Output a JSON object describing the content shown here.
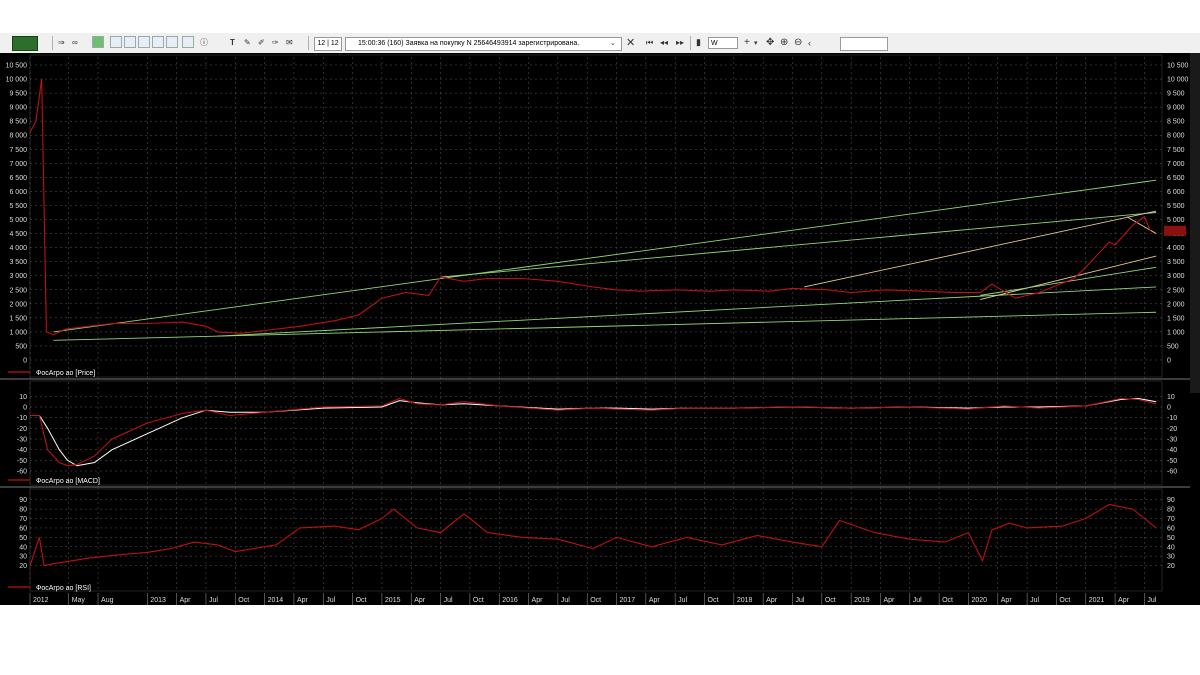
{
  "toolbar": {
    "page_counter": "12 | 12",
    "message": "15:00:36  (160) Заявка на покупку N 25646493914 зарегистрирована.",
    "timeframe": "W",
    "icons": [
      "terminal-logo-icon",
      "arrow-icon",
      "link-icon",
      "refresh-icon",
      "window-icon",
      "table-icon",
      "list-icon",
      "zoom-icon",
      "filter-icon",
      "info-icon",
      "text-tool-icon",
      "pencil-icon",
      "eraser-icon",
      "brush-icon",
      "message-icon",
      "close-icon",
      "first-icon",
      "prev-icon",
      "next-icon",
      "chart-type-icon",
      "crosshair-icon",
      "move-icon",
      "zoom-in-icon",
      "zoom-out-icon"
    ]
  },
  "panes": {
    "price": {
      "legend": "ФосАгро ао [Price]",
      "color": "#c01010"
    },
    "macd": {
      "legend": "ФосАгро ао [MACD]",
      "color": "#c01010",
      "signal_color": "#ffffff"
    },
    "rsi": {
      "legend": "ФосАгро ао [RSI]",
      "color": "#c01010"
    }
  },
  "chart_data": [
    {
      "type": "line",
      "name": "price",
      "ylim": [
        0,
        10500
      ],
      "yticks": [
        0,
        500,
        1000,
        1500,
        2000,
        2500,
        3000,
        3500,
        4000,
        4500,
        5000,
        5500,
        6000,
        6500,
        7000,
        7500,
        8000,
        8500,
        9000,
        9500,
        10000,
        10500
      ],
      "ytick_labels": [
        "0",
        "500",
        "1 000",
        "1 500",
        "2 000",
        "2 500",
        "3 000",
        "3 500",
        "4 000",
        "4 500",
        "5 000",
        "5 500",
        "6 000",
        "6 500",
        "7 000",
        "7 500",
        "8 000",
        "8 500",
        "9 000",
        "9 500",
        "10 000",
        "10 500"
      ],
      "x": [
        2012.0,
        2012.05,
        2012.1,
        2012.14,
        2012.2,
        2012.3,
        2012.5,
        2012.7,
        2013.0,
        2013.3,
        2013.5,
        2013.6,
        2013.8,
        2014.0,
        2014.3,
        2014.6,
        2014.8,
        2015.0,
        2015.2,
        2015.4,
        2015.5,
        2015.7,
        2015.9,
        2016.2,
        2016.5,
        2016.8,
        2017.0,
        2017.2,
        2017.5,
        2017.8,
        2018.0,
        2018.3,
        2018.5,
        2018.8,
        2019.0,
        2019.3,
        2019.6,
        2019.9,
        2020.1,
        2020.2,
        2020.4,
        2020.6,
        2020.9,
        2021.0,
        2021.2,
        2021.25,
        2021.4,
        2021.5,
        2021.55
      ],
      "values": [
        8100,
        8500,
        10000,
        1000,
        900,
        1100,
        1200,
        1300,
        1300,
        1350,
        1200,
        1000,
        950,
        1050,
        1200,
        1400,
        1600,
        2200,
        2400,
        2300,
        2950,
        2800,
        2900,
        2900,
        2800,
        2600,
        2500,
        2450,
        2500,
        2450,
        2500,
        2450,
        2550,
        2500,
        2400,
        2500,
        2450,
        2400,
        2400,
        2700,
        2200,
        2400,
        2900,
        3300,
        4200,
        4100,
        4800,
        5100,
        4600
      ],
      "trend_lines": [
        {
          "from": [
            2012.2,
            1000
          ],
          "to": [
            2021.6,
            6400
          ],
          "color": "#90d878"
        },
        {
          "from": [
            2012.2,
            700
          ],
          "to": [
            2021.6,
            1700
          ],
          "color": "#90d878"
        },
        {
          "from": [
            2013.6,
            850
          ],
          "to": [
            2021.6,
            2600
          ],
          "color": "#90d878"
        },
        {
          "from": [
            2015.5,
            2950
          ],
          "to": [
            2021.6,
            5250
          ],
          "color": "#90d878"
        },
        {
          "from": [
            2018.6,
            2600
          ],
          "to": [
            2021.6,
            5300
          ],
          "color": "#e8c890"
        },
        {
          "from": [
            2020.1,
            2150
          ],
          "to": [
            2021.6,
            3700
          ],
          "color": "#e8c890"
        },
        {
          "from": [
            2020.1,
            2300
          ],
          "to": [
            2021.6,
            3300
          ],
          "color": "#90d878"
        },
        {
          "from": [
            2021.35,
            5100
          ],
          "to": [
            2021.6,
            4500
          ],
          "color": "#e8c890"
        }
      ],
      "last_value_label_color": "#8a1010"
    },
    {
      "type": "line",
      "name": "macd",
      "ylim": [
        -60,
        15
      ],
      "yticks": [
        -60,
        -50,
        -40,
        -30,
        -20,
        -10,
        0,
        10
      ],
      "x": [
        2012.0,
        2012.08,
        2012.15,
        2012.25,
        2012.32,
        2012.4,
        2012.55,
        2012.7,
        2013.0,
        2013.3,
        2013.5,
        2013.7,
        2014.0,
        2014.5,
        2015.0,
        2015.15,
        2015.3,
        2015.5,
        2015.7,
        2016.0,
        2016.5,
        2016.8,
        2017.0,
        2017.3,
        2017.6,
        2018.0,
        2018.5,
        2019.0,
        2019.5,
        2020.0,
        2020.3,
        2020.6,
        2021.0,
        2021.3,
        2021.45,
        2021.6
      ],
      "values": [
        -8,
        -8,
        -40,
        -52,
        -55,
        -54,
        -46,
        -30,
        -15,
        -6,
        -3,
        -8,
        -5,
        0,
        1,
        8,
        3,
        2,
        5,
        1,
        -3,
        -1,
        -2,
        -3,
        -1,
        -1,
        0,
        -1,
        0,
        -2,
        1,
        -1,
        1,
        8,
        7,
        3
      ],
      "signal": [
        -8,
        -8,
        -20,
        -40,
        -50,
        -55,
        -52,
        -40,
        -25,
        -10,
        -3,
        -5,
        -5,
        -1,
        0,
        6,
        4,
        2,
        3,
        1,
        -2,
        -1,
        -1,
        -2,
        -1,
        -1,
        0,
        -1,
        0,
        -1,
        0,
        0,
        1,
        7,
        8,
        5
      ]
    },
    {
      "type": "line",
      "name": "rsi",
      "ylim": [
        10,
        95
      ],
      "yticks": [
        20,
        30,
        40,
        50,
        60,
        70,
        80,
        90
      ],
      "x": [
        2012.0,
        2012.08,
        2012.12,
        2012.2,
        2012.35,
        2012.5,
        2012.8,
        2013.0,
        2013.2,
        2013.4,
        2013.6,
        2013.75,
        2014.0,
        2014.1,
        2014.3,
        2014.6,
        2014.8,
        2015.0,
        2015.1,
        2015.3,
        2015.5,
        2015.7,
        2015.9,
        2016.2,
        2016.5,
        2016.8,
        2017.0,
        2017.3,
        2017.6,
        2017.9,
        2018.2,
        2018.5,
        2018.75,
        2018.9,
        2019.2,
        2019.5,
        2019.8,
        2020.0,
        2020.12,
        2020.2,
        2020.35,
        2020.5,
        2020.8,
        2021.0,
        2021.2,
        2021.4,
        2021.5,
        2021.6
      ],
      "values": [
        20,
        50,
        20,
        22,
        25,
        28,
        32,
        34,
        38,
        45,
        42,
        35,
        40,
        42,
        60,
        62,
        58,
        70,
        80,
        60,
        55,
        75,
        55,
        50,
        48,
        38,
        50,
        40,
        50,
        42,
        52,
        45,
        40,
        68,
        55,
        48,
        45,
        55,
        25,
        58,
        65,
        60,
        62,
        70,
        85,
        80,
        70,
        60
      ]
    }
  ],
  "x_axis": {
    "labels": [
      "2012",
      "May",
      "Aug",
      "2013",
      "Apr",
      "Jul",
      "Oct",
      "2014",
      "Apr",
      "Jul",
      "Oct",
      "2015",
      "Apr",
      "Jul",
      "Oct",
      "2016",
      "Apr",
      "Jul",
      "Oct",
      "2017",
      "Apr",
      "Jul",
      "Oct",
      "2018",
      "Apr",
      "Jul",
      "Oct",
      "2019",
      "Apr",
      "Jul",
      "Oct",
      "2020",
      "Apr",
      "Jul",
      "Oct",
      "2021",
      "Apr",
      "Jul"
    ],
    "positions": [
      2012.0,
      2012.33,
      2012.58,
      2013.0,
      2013.25,
      2013.5,
      2013.75,
      2014.0,
      2014.25,
      2014.5,
      2014.75,
      2015.0,
      2015.25,
      2015.5,
      2015.75,
      2016.0,
      2016.25,
      2016.5,
      2016.75,
      2017.0,
      2017.25,
      2017.5,
      2017.75,
      2018.0,
      2018.25,
      2018.5,
      2018.75,
      2019.0,
      2019.25,
      2019.5,
      2019.75,
      2020.0,
      2020.25,
      2020.5,
      2020.75,
      2021.0,
      2021.25,
      2021.5
    ]
  }
}
